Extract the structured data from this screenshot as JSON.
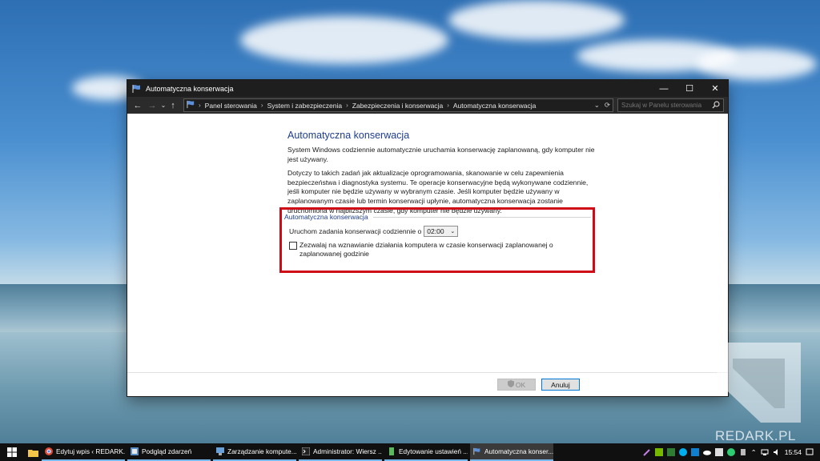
{
  "window": {
    "title": "Automatyczna konserwacja",
    "breadcrumbs": [
      "Panel sterowania",
      "System i zabezpieczenia",
      "Zabezpieczenia i konserwacja",
      "Automatyczna konserwacja"
    ],
    "search_placeholder": "Szukaj w Panelu sterowania"
  },
  "main": {
    "title": "Automatyczna konserwacja",
    "para1": "System Windows codziennie automatycznie uruchamia konserwację zaplanowaną, gdy komputer nie jest używany.",
    "para2": "Dotyczy to takich zadań jak aktualizacje oprogramowania, skanowanie w celu zapewnienia bezpieczeństwa i diagnostyka systemu. Te operacje konserwacyjne będą wykonywane codziennie, jeśli komputer nie będzie używany w wybranym czasie. Jeśli komputer będzie używany w zaplanowanym czasie lub termin konserwacji upłynie, automatyczna konserwacja zostanie uruchomiona w najbliższym czasie, gdy komputer nie będzie używany.",
    "group_label": "Automatyczna konserwacja",
    "run_label": "Uruchom zadania konserwacji codziennie o",
    "time_value": "02:00",
    "allow_wake_label": "Zezwalaj na wznawianie działania komputera w czasie konserwacji zaplanowanej o zaplanowanej godzinie",
    "allow_wake_checked": false
  },
  "footer": {
    "ok_label": "OK",
    "cancel_label": "Anuluj"
  },
  "watermark": "REDARK.PL",
  "taskbar": {
    "items": [
      {
        "label": "Edytuj wpis ‹ REDARK..."
      },
      {
        "label": "Podgląd zdarzeń"
      },
      {
        "label": "Zarządzanie kompute..."
      },
      {
        "label": "Administrator: Wiersz ..."
      },
      {
        "label": "Edytowanie ustawień ..."
      },
      {
        "label": "Automatyczna konser..."
      }
    ],
    "clock": "15:54"
  },
  "colors": {
    "highlight": "#cf0a16",
    "title_blue": "#1e3d8f",
    "taskbar_bg": "#101010"
  }
}
